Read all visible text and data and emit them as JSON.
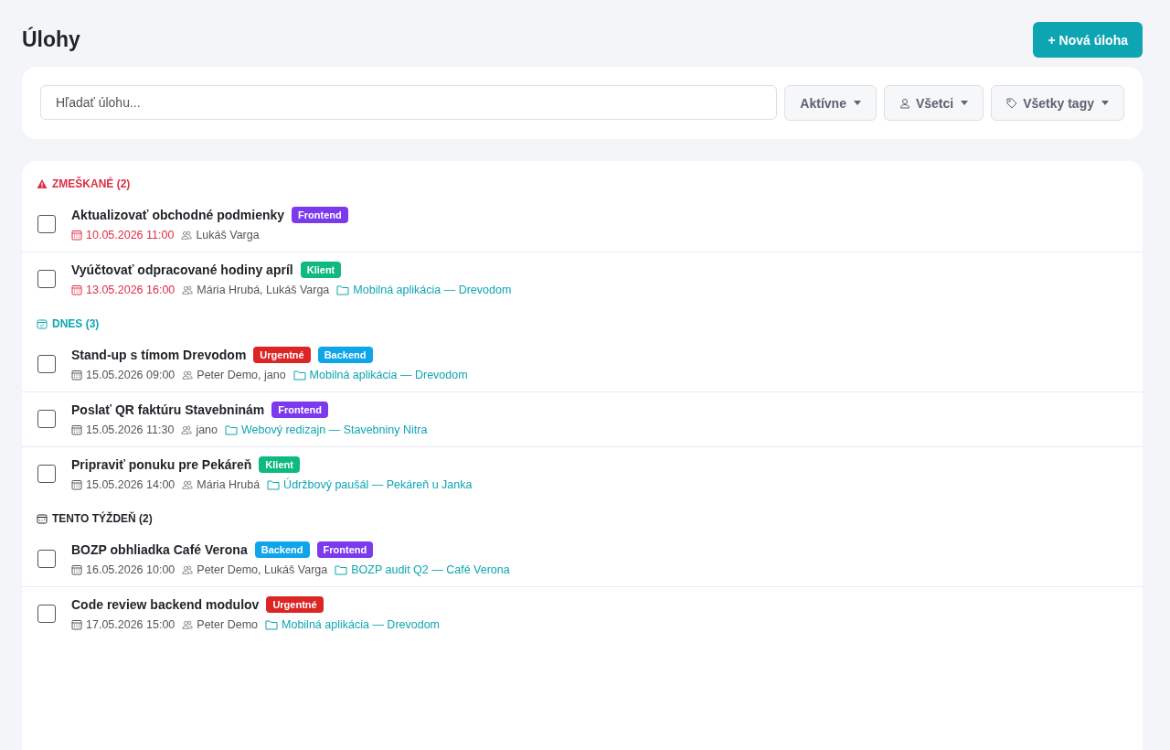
{
  "page": {
    "title": "Úlohy",
    "new_button": "+ Nová úloha"
  },
  "filters": {
    "search": {
      "placeholder": "Hľadať úlohu..."
    },
    "dropdowns": [
      {
        "kind": "status",
        "label": "Aktívne"
      },
      {
        "kind": "person",
        "label": "Všetci"
      },
      {
        "kind": "tag",
        "label": "Všetky tagy"
      }
    ]
  },
  "sections": [
    {
      "kind": "overdue",
      "title": "ZMEŠKANÉ (2)",
      "tasks": [
        {
          "title": "Aktualizovať obchodné podmienky",
          "checked": false,
          "tags": [
            {
              "label": "Frontend",
              "color": "#7c3aed"
            }
          ],
          "date": "10.05.2026 11:00",
          "people": "Lukáš Varga"
        },
        {
          "title": "Vyúčtovať odpracované hodiny apríl",
          "checked": false,
          "tags": [
            {
              "label": "Klient",
              "color": "#10b981"
            }
          ],
          "date": "13.05.2026 16:00",
          "people": "Mária Hrubá, Lukáš Varga",
          "project": "Mobilná aplikácia — Drevodom"
        }
      ]
    },
    {
      "kind": "today",
      "title": "DNES (3)",
      "tasks": [
        {
          "title": "Stand-up s tímom Drevodom",
          "checked": false,
          "tags": [
            {
              "label": "Urgentné",
              "color": "#dc2626"
            },
            {
              "label": "Backend",
              "color": "#0ea5e9"
            }
          ],
          "date": "15.05.2026 09:00",
          "people": "Peter Demo, jano",
          "project": "Mobilná aplikácia — Drevodom"
        },
        {
          "title": "Poslať QR faktúru Stavebninám",
          "checked": false,
          "tags": [
            {
              "label": "Frontend",
              "color": "#7c3aed"
            }
          ],
          "date": "15.05.2026 11:30",
          "people": "jano",
          "project": "Webový redizajn — Stavebniny Nitra"
        },
        {
          "title": "Pripraviť ponuku pre Pekáreň",
          "checked": false,
          "tags": [
            {
              "label": "Klient",
              "color": "#10b981"
            }
          ],
          "date": "15.05.2026 14:00",
          "people": "Mária Hrubá",
          "project": "Údržbový paušál — Pekáreň u Janka"
        }
      ]
    },
    {
      "kind": "week",
      "title": "TENTO TÝŽDEŇ (2)",
      "tasks": [
        {
          "title": "BOZP obhliadka Café Verona",
          "checked": false,
          "tags": [
            {
              "label": "Backend",
              "color": "#0ea5e9"
            },
            {
              "label": "Frontend",
              "color": "#7c3aed"
            }
          ],
          "date": "16.05.2026 10:00",
          "people": "Peter Demo, Lukáš Varga",
          "project": "BOZP audit Q2 — Café Verona"
        },
        {
          "title": "Code review backend modulov",
          "checked": false,
          "tags": [
            {
              "label": "Urgentné",
              "color": "#dc2626"
            }
          ],
          "date": "17.05.2026 15:00",
          "people": "Peter Demo",
          "project": "Mobilná aplikácia — Drevodom"
        }
      ]
    }
  ]
}
